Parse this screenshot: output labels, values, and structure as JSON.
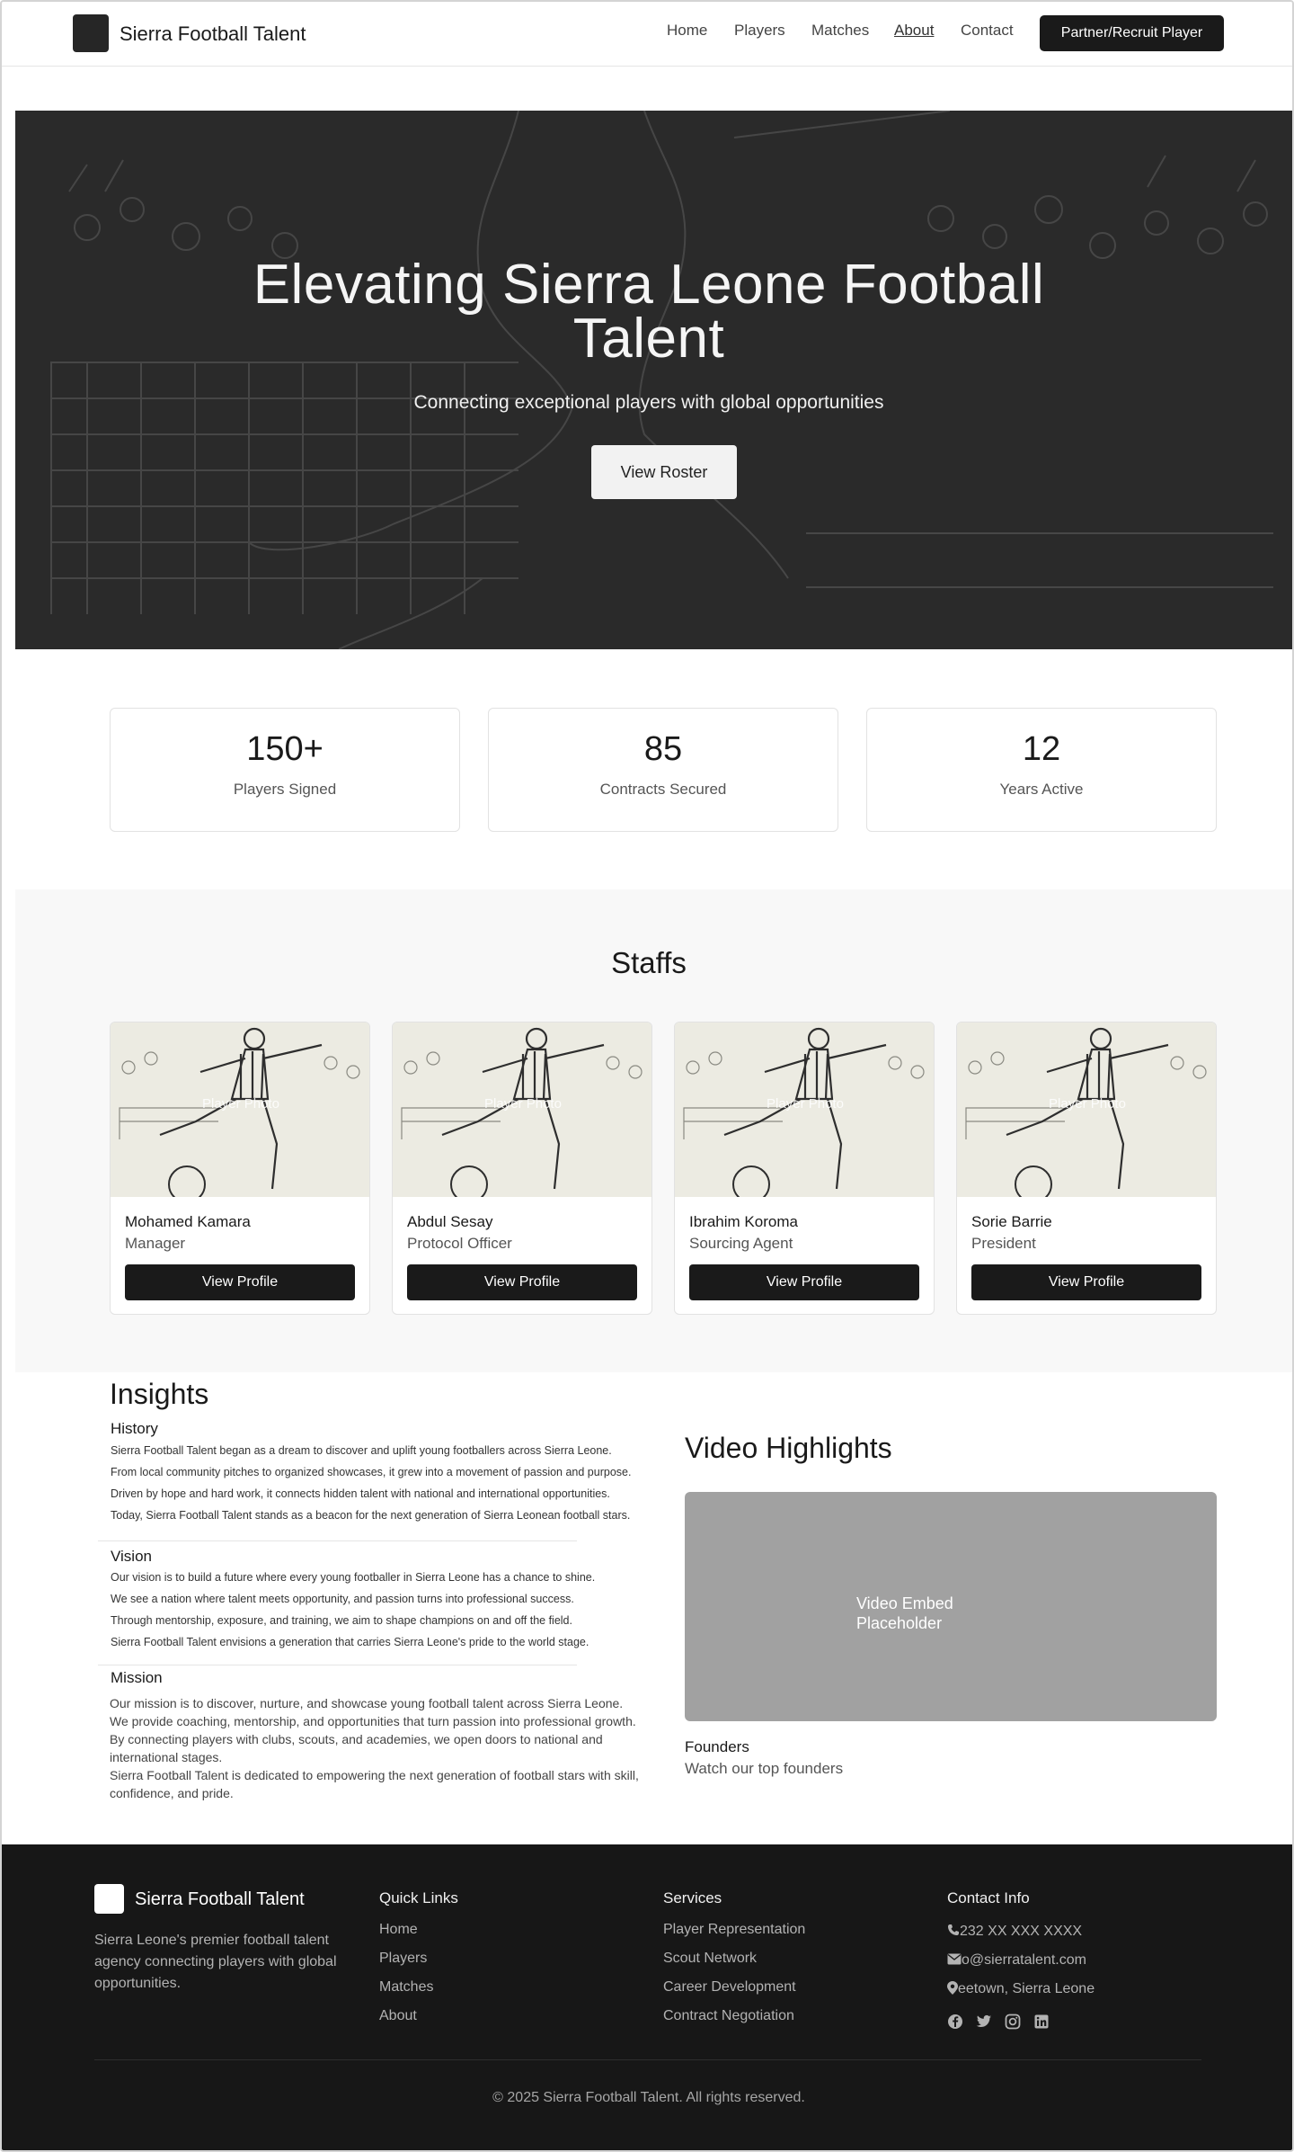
{
  "header": {
    "brand": "Sierra Football Talent",
    "nav": [
      "Home",
      "Players",
      "Matches",
      "About",
      "Contact"
    ],
    "active_nav": "About",
    "cta": "Partner/Recruit Player"
  },
  "hero": {
    "title_line1": "Elevating Sierra Leone Football",
    "title_line2": "Talent",
    "subtitle": "Connecting exceptional players with global opportunities",
    "button": "View Roster"
  },
  "stats": [
    {
      "value": "150+",
      "label": "Players Signed"
    },
    {
      "value": "85",
      "label": "Contracts Secured"
    },
    {
      "value": "12",
      "label": "Years Active"
    }
  ],
  "staff": {
    "title": "Staffs",
    "photo_placeholder": "Player Photo",
    "view_label": "View Profile",
    "members": [
      {
        "name": "Mohamed Kamara",
        "role": "Manager"
      },
      {
        "name": "Abdul Sesay",
        "role": "Protocol Officer"
      },
      {
        "name": "Ibrahim Koroma",
        "role": "Sourcing Agent"
      },
      {
        "name": "Sorie Barrie",
        "role": "President"
      }
    ]
  },
  "insights": {
    "title": "Insights",
    "history": {
      "heading": "History",
      "lines": [
        "Sierra Football Talent began as a dream to discover and uplift young footballers across Sierra Leone.",
        " From local community pitches to organized showcases, it grew into a movement of passion and purpose.",
        " Driven by hope and hard work, it connects hidden talent with national and international opportunities.",
        " Today, Sierra Football Talent stands as a beacon for the next generation of Sierra Leonean football stars."
      ]
    },
    "vision": {
      "heading": "Vision",
      "lines": [
        "Our vision is to build a future where every young footballer in Sierra Leone has a chance to shine.",
        " We see a nation where talent meets opportunity, and passion turns into professional success.",
        " Through mentorship, exposure, and training, we aim to shape champions on and off the field.",
        " Sierra Football Talent envisions a generation that carries Sierra Leone's pride to the world stage."
      ]
    },
    "mission": {
      "heading": "Mission",
      "lines": [
        "Our mission is to discover, nurture, and showcase young football talent across Sierra Leone.",
        " We provide coaching, mentorship, and opportunities that turn passion into professional growth.",
        " By connecting players with clubs, scouts, and academies, we open doors to national and international stages.",
        " Sierra Football Talent is dedicated to empowering the next generation of football stars with skill, confidence, and pride."
      ]
    }
  },
  "video": {
    "title": "Video Highlights",
    "placeholder_line1": "Video Embed",
    "placeholder_line2": "Placeholder",
    "founders_heading": "Founders",
    "founders_sub": "Watch our top founders"
  },
  "footer": {
    "brand": "Sierra Football Talent",
    "description": "Sierra Leone's premier football talent agency connecting players with global opportunities.",
    "quick_links_heading": "Quick Links",
    "quick_links": [
      "Home",
      "Players",
      "Matches",
      "About"
    ],
    "services_heading": "Services",
    "services": [
      "Player Representation",
      "Scout Network",
      "Career Development",
      "Contract Negotiation"
    ],
    "contact_heading": "Contact Info",
    "phone": "232 XX XXX XXXX",
    "email": "o@sierratalent.com",
    "location": "eetown, Sierra Leone",
    "social": [
      "facebook-icon",
      "twitter-icon",
      "instagram-icon",
      "linkedin-icon"
    ],
    "copyright": "© 2025 Sierra Football Talent. All rights reserved."
  }
}
